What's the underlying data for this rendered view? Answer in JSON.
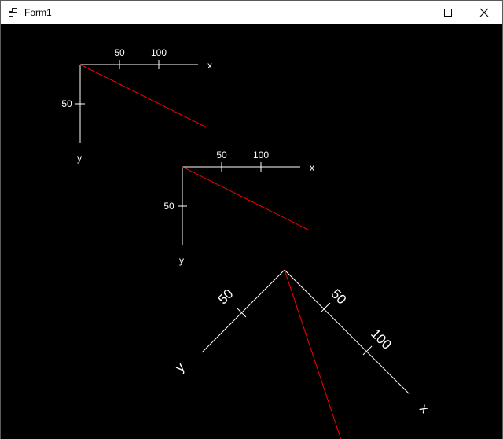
{
  "window": {
    "title": "Form1",
    "controls": {
      "minimize_icon": "minimize-icon",
      "maximize_icon": "maximize-icon",
      "close_icon": "close-icon"
    }
  },
  "canvas": {
    "background": "#000000",
    "axis_color": "#ffffff",
    "line_color": "#ff0000",
    "plots": [
      {
        "x_ticks": [
          "50",
          "100"
        ],
        "y_ticks": [
          "50"
        ],
        "x_label": "x",
        "y_label": "y"
      },
      {
        "x_ticks": [
          "50",
          "100"
        ],
        "y_ticks": [
          "50"
        ],
        "x_label": "x",
        "y_label": "y"
      },
      {
        "x_ticks": [
          "50",
          "100"
        ],
        "y_ticks": [
          "50"
        ],
        "x_label": "x",
        "y_label": "y"
      }
    ]
  }
}
